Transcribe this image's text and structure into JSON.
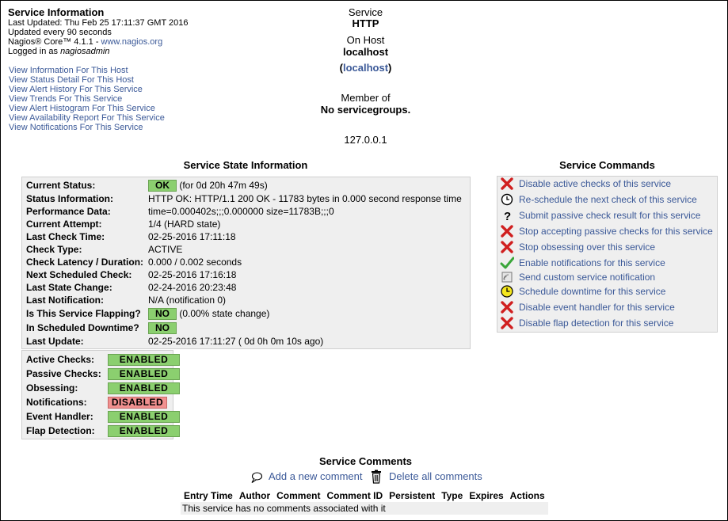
{
  "info": {
    "title": "Service Information",
    "last_updated": "Last Updated: Thu Feb 25 17:11:37 GMT 2016",
    "update_interval": "Updated every 90 seconds",
    "core_prefix": "Nagios® Core™ 4.1.1 - ",
    "core_link": "www.nagios.org",
    "logged_in_prefix": "Logged in as ",
    "logged_in_user": "nagiosadmin"
  },
  "nav_links": [
    "View Information For This Host",
    "View Status Detail For This Host",
    "View Alert History For This Service",
    "View Trends For This Service",
    "View Alert Histogram For This Service",
    "View Availability Report For This Service",
    "View Notifications For This Service"
  ],
  "service_header": {
    "service_label": "Service",
    "service_name": "HTTP",
    "on_host_label": "On Host",
    "host_name": "localhost",
    "host_alias_open": "(",
    "host_alias": "localhost",
    "host_alias_close": ")",
    "member_of_label": "Member of",
    "servicegroups": "No servicegroups.",
    "address": "127.0.0.1"
  },
  "state": {
    "title": "Service State Information",
    "rows": [
      {
        "label": "Current Status:",
        "badge": "OK",
        "value": " (for 0d 20h 47m 49s)"
      },
      {
        "label": "Status Information:",
        "value": "HTTP OK: HTTP/1.1 200 OK - 11783 bytes in 0.000 second response time"
      },
      {
        "label": "Performance Data:",
        "value": "time=0.000402s;;;0.000000 size=11783B;;;0"
      },
      {
        "label": "Current Attempt:",
        "value": "1/4  (HARD state)"
      },
      {
        "label": "Last Check Time:",
        "value": "02-25-2016 17:11:18"
      },
      {
        "label": "Check Type:",
        "value": "ACTIVE"
      },
      {
        "label": "Check Latency / Duration:",
        "value": "0.000 / 0.002 seconds"
      },
      {
        "label": "Next Scheduled Check:",
        "value": "02-25-2016 17:16:18"
      },
      {
        "label": "Last State Change:",
        "value": "02-24-2016 20:23:48"
      },
      {
        "label": "Last Notification:",
        "value": "N/A (notification 0)"
      },
      {
        "label": "Is This Service Flapping?",
        "badge": "NO",
        "value": " (0.00% state change)"
      },
      {
        "label": "In Scheduled Downtime?",
        "badge": "NO",
        "value": ""
      },
      {
        "label": "Last Update:",
        "value": "02-25-2016 17:11:27  ( 0d 0h 0m 10s ago)"
      }
    ]
  },
  "flags": [
    {
      "label": "Active Checks:",
      "value": "ENABLED",
      "status": "ok"
    },
    {
      "label": "Passive Checks:",
      "value": "ENABLED",
      "status": "ok"
    },
    {
      "label": "Obsessing:",
      "value": "ENABLED",
      "status": "ok"
    },
    {
      "label": "Notifications:",
      "value": "DISABLED",
      "status": "bad"
    },
    {
      "label": "Event Handler:",
      "value": "ENABLED",
      "status": "ok"
    },
    {
      "label": "Flap Detection:",
      "value": "ENABLED",
      "status": "ok"
    }
  ],
  "commands": {
    "title": "Service Commands",
    "items": [
      {
        "icon": "red-x-icon",
        "label": "Disable active checks of this service"
      },
      {
        "icon": "clock-icon",
        "label": "Re-schedule the next check of this service"
      },
      {
        "icon": "question-mark-icon",
        "label": "Submit passive check result for this service"
      },
      {
        "icon": "red-x-icon",
        "label": "Stop accepting passive checks for this service"
      },
      {
        "icon": "red-x-icon",
        "label": "Stop obsessing over this service"
      },
      {
        "icon": "green-check-icon",
        "label": "Enable notifications for this service"
      },
      {
        "icon": "notification-icon",
        "label": "Send custom service notification"
      },
      {
        "icon": "yellow-clock-icon",
        "label": "Schedule downtime for this service"
      },
      {
        "icon": "red-x-icon",
        "label": "Disable event handler for this service"
      },
      {
        "icon": "red-x-icon",
        "label": "Disable flap detection for this service"
      }
    ]
  },
  "comments": {
    "title": "Service Comments",
    "add_label": "Add a new comment",
    "delete_label": "Delete all comments",
    "columns": [
      "Entry Time",
      "Author",
      "Comment",
      "Comment ID",
      "Persistent",
      "Type",
      "Expires",
      "Actions"
    ],
    "empty_message": "This service has no comments associated with it"
  },
  "colors": {
    "link": "#3b5998",
    "ok_badge": "#8bcf6f",
    "disabled_badge": "#f1908f",
    "panel_bg": "#efefef"
  }
}
